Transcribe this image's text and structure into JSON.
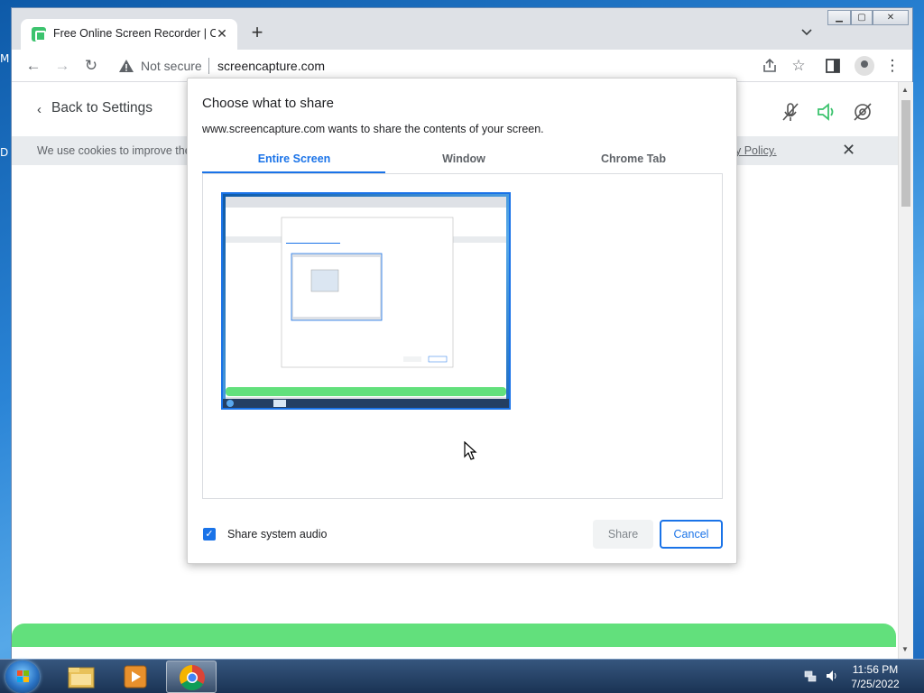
{
  "browser": {
    "tab_title": "Free Online Screen Recorder | Or",
    "new_tab_label": "+",
    "status_label": "Not secure",
    "url": "screencapture.com",
    "window_controls": {
      "minimize": "▁",
      "maximize": "▢",
      "close": "✕"
    }
  },
  "page": {
    "back_label": "Back to Settings",
    "cookie_text": "We use cookies to improve the",
    "cookie_policy_link": "y Policy.",
    "header_icons": [
      "mic-off-icon",
      "speaker-on-icon",
      "camera-off-icon"
    ]
  },
  "dialog": {
    "title": "Choose what to share",
    "subtitle": "www.screencapture.com wants to share the contents of your screen.",
    "tabs": [
      {
        "label": "Entire Screen",
        "active": true
      },
      {
        "label": "Window",
        "active": false
      },
      {
        "label": "Chrome Tab",
        "active": false
      }
    ],
    "audio_checkbox_label": "Share system audio",
    "audio_checked": true,
    "share_button": "Share",
    "cancel_button": "Cancel"
  },
  "taskbar": {
    "time": "11:56 PM",
    "date": "7/25/2022",
    "apps": [
      "file-explorer-icon",
      "media-player-icon",
      "chrome-icon"
    ]
  },
  "colors": {
    "accent": "#1a73e8",
    "green_active": "#3cc36e",
    "brand_green_bar": "#62e07c"
  }
}
